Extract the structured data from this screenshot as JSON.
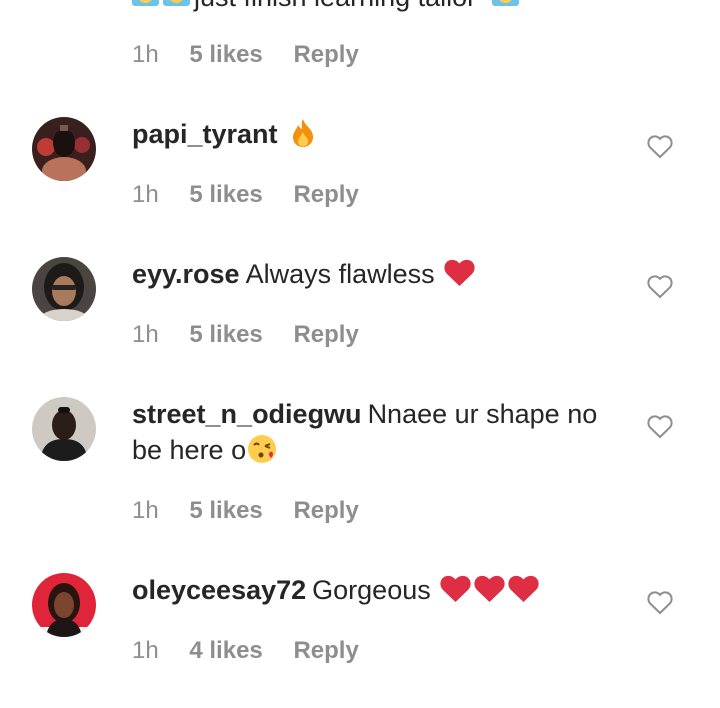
{
  "partial_comment": {
    "text": "just finish learning tailor",
    "leading_emoji": [
      "screaming-face-emoji",
      "screaming-face-emoji"
    ],
    "trailing_emoji": "screaming-face-emoji"
  },
  "partial_meta": {
    "time": "1h",
    "likes": "5 likes",
    "reply": "Reply"
  },
  "comments": [
    {
      "username": "papi_tyrant",
      "text": "",
      "emoji": "fire-emoji",
      "time": "1h",
      "likes": "5 likes",
      "reply": "Reply"
    },
    {
      "username": "eyy.rose",
      "text": "Always flawless",
      "emoji": "red-heart-emoji",
      "time": "1h",
      "likes": "5 likes",
      "reply": "Reply"
    },
    {
      "username": "street_n_odiegwu",
      "text": "Nnaee ur shape no be here o",
      "emoji": "kiss-emoji",
      "time": "1h",
      "likes": "5 likes",
      "reply": "Reply"
    },
    {
      "username": "oleyceesay72",
      "text": "Gorgeous",
      "emoji": "three-red-hearts-emoji",
      "time": "1h",
      "likes": "4 likes",
      "reply": "Reply"
    }
  ],
  "colors": {
    "primary_text": "#262626",
    "secondary_text": "#8e8e8e",
    "heart_red": "#e0192d",
    "background": "#ffffff"
  }
}
